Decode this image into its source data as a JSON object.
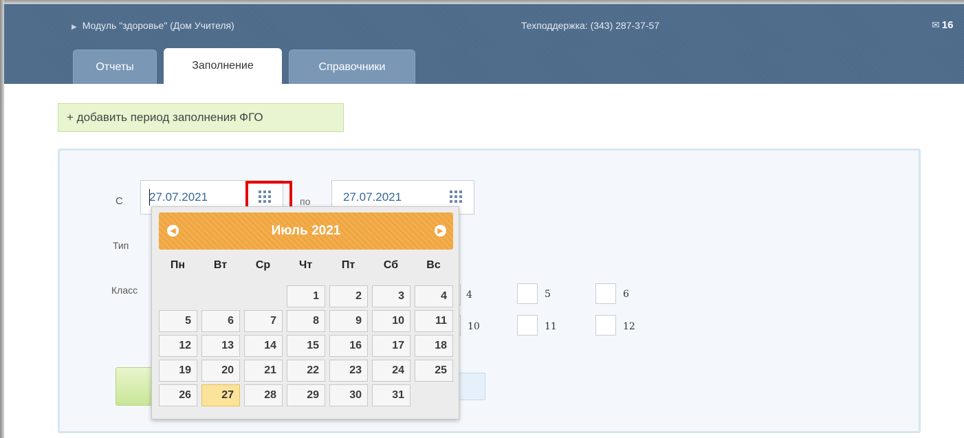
{
  "header": {
    "module_title": "Модуль \"здоровье\" (Дом Учителя)",
    "support_text": "Техподдержка: (343) 287-37-57",
    "mail_count": "16"
  },
  "tabs": [
    {
      "label": "Отчеты",
      "active": false
    },
    {
      "label": "Заполнение",
      "active": true
    },
    {
      "label": "Справочники",
      "active": false
    }
  ],
  "add_period_button": "+ добавить период заполнения ФГО",
  "form": {
    "from_label": "С",
    "to_label": "по",
    "from_date": "27.07.2021",
    "to_date": "27.07.2021",
    "type_label": "Тип",
    "class_label": "Класс",
    "class_checkboxes_row1": [
      "4",
      "5",
      "6"
    ],
    "class_checkboxes_row2": [
      "10",
      "11",
      "12"
    ]
  },
  "datepicker": {
    "month_title": "Июль 2021",
    "weekdays": [
      "Пн",
      "Вт",
      "Ср",
      "Чт",
      "Пт",
      "Сб",
      "Вс"
    ],
    "first_weekday_index": 3,
    "days_in_month": 31,
    "selected_day": 27,
    "prev_icon": "chevron-left-icon",
    "next_icon": "chevron-right-icon",
    "accent_color": "#f0a640",
    "today_color": "#fbe39a"
  },
  "colors": {
    "header_bg": "#4d6a8a",
    "highlight_border": "#e60000"
  }
}
